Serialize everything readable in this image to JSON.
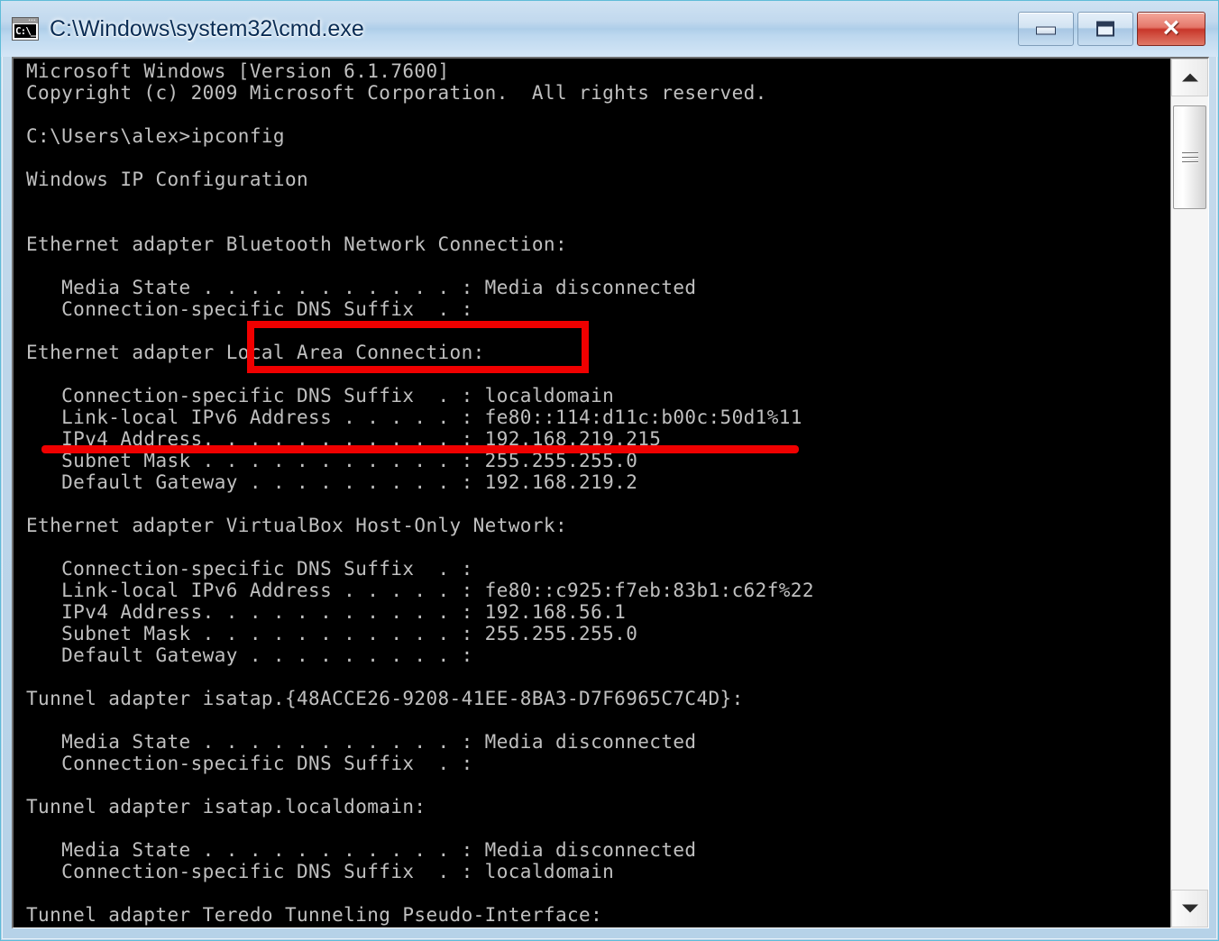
{
  "window": {
    "title": "C:\\Windows\\system32\\cmd.exe",
    "icon_label": "C:\\_",
    "icon_name": "cmd-console-icon",
    "accent_annotation_color": "#f00000",
    "console_bg": "#000000",
    "console_fg": "#c0c0c0",
    "titlebar_color": "#bdd6ea"
  },
  "controls": {
    "minimize_label": "–",
    "maximize_label": "□",
    "close_label": "✕",
    "minimize_name": "minimize-button",
    "maximize_name": "maximize-button",
    "close_name": "close-button"
  },
  "scrollbar": {
    "up_label": "▲",
    "down_label": "▼"
  },
  "console": {
    "prompt_path": "C:\\Users\\alex>",
    "command": "ipconfig",
    "lines": [
      "Microsoft Windows [Version 6.1.7600]",
      "Copyright (c) 2009 Microsoft Corporation.  All rights reserved.",
      "",
      "C:\\Users\\alex>ipconfig",
      "",
      "Windows IP Configuration",
      "",
      "",
      "Ethernet adapter Bluetooth Network Connection:",
      "",
      "   Media State . . . . . . . . . . . : Media disconnected",
      "   Connection-specific DNS Suffix  . :",
      "",
      "Ethernet adapter Local Area Connection:",
      "",
      "   Connection-specific DNS Suffix  . : localdomain",
      "   Link-local IPv6 Address . . . . . : fe80::114:d11c:b00c:50d1%11",
      "   IPv4 Address. . . . . . . . . . . : 192.168.219.215",
      "   Subnet Mask . . . . . . . . . . . : 255.255.255.0",
      "   Default Gateway . . . . . . . . . : 192.168.219.2",
      "",
      "Ethernet adapter VirtualBox Host-Only Network:",
      "",
      "   Connection-specific DNS Suffix  . :",
      "   Link-local IPv6 Address . . . . . : fe80::c925:f7eb:83b1:c62f%22",
      "   IPv4 Address. . . . . . . . . . . : 192.168.56.1",
      "   Subnet Mask . . . . . . . . . . . : 255.255.255.0",
      "   Default Gateway . . . . . . . . . :",
      "",
      "Tunnel adapter isatap.{48ACCE26-9208-41EE-8BA3-D7F6965C7C4D}:",
      "",
      "   Media State . . . . . . . . . . . : Media disconnected",
      "   Connection-specific DNS Suffix  . :",
      "",
      "Tunnel adapter isatap.localdomain:",
      "",
      "   Media State . . . . . . . . . . . : Media disconnected",
      "   Connection-specific DNS Suffix  . : localdomain",
      "",
      "Tunnel adapter Teredo Tunneling Pseudo-Interface:"
    ],
    "adapters": [
      {
        "name": "Bluetooth Network Connection",
        "type": "Ethernet adapter",
        "media_state": "Media disconnected",
        "dns_suffix": ""
      },
      {
        "name": "Local Area Connection",
        "type": "Ethernet adapter",
        "dns_suffix": "localdomain",
        "ipv6_link_local": "fe80::114:d11c:b00c:50d1%11",
        "ipv4": "192.168.219.215",
        "subnet_mask": "255.255.255.0",
        "default_gateway": "192.168.219.2",
        "highlighted": true
      },
      {
        "name": "VirtualBox Host-Only Network",
        "type": "Ethernet adapter",
        "dns_suffix": "",
        "ipv6_link_local": "fe80::c925:f7eb:83b1:c62f%22",
        "ipv4": "192.168.56.1",
        "subnet_mask": "255.255.255.0",
        "default_gateway": ""
      },
      {
        "name": "isatap.{48ACCE26-9208-41EE-8BA3-D7F6965C7C4D}",
        "type": "Tunnel adapter",
        "media_state": "Media disconnected",
        "dns_suffix": ""
      },
      {
        "name": "isatap.localdomain",
        "type": "Tunnel adapter",
        "media_state": "Media disconnected",
        "dns_suffix": "localdomain"
      },
      {
        "name": "Teredo Tunneling Pseudo-Interface",
        "type": "Tunnel adapter"
      }
    ]
  },
  "annotations": [
    {
      "kind": "rectangle",
      "target_text": "Local Area Connection:",
      "color": "#f00000"
    },
    {
      "kind": "underline",
      "target_text": "IPv4 Address. . . . . . . . . . . : 192.168.219.215",
      "color": "#f00000"
    }
  ]
}
